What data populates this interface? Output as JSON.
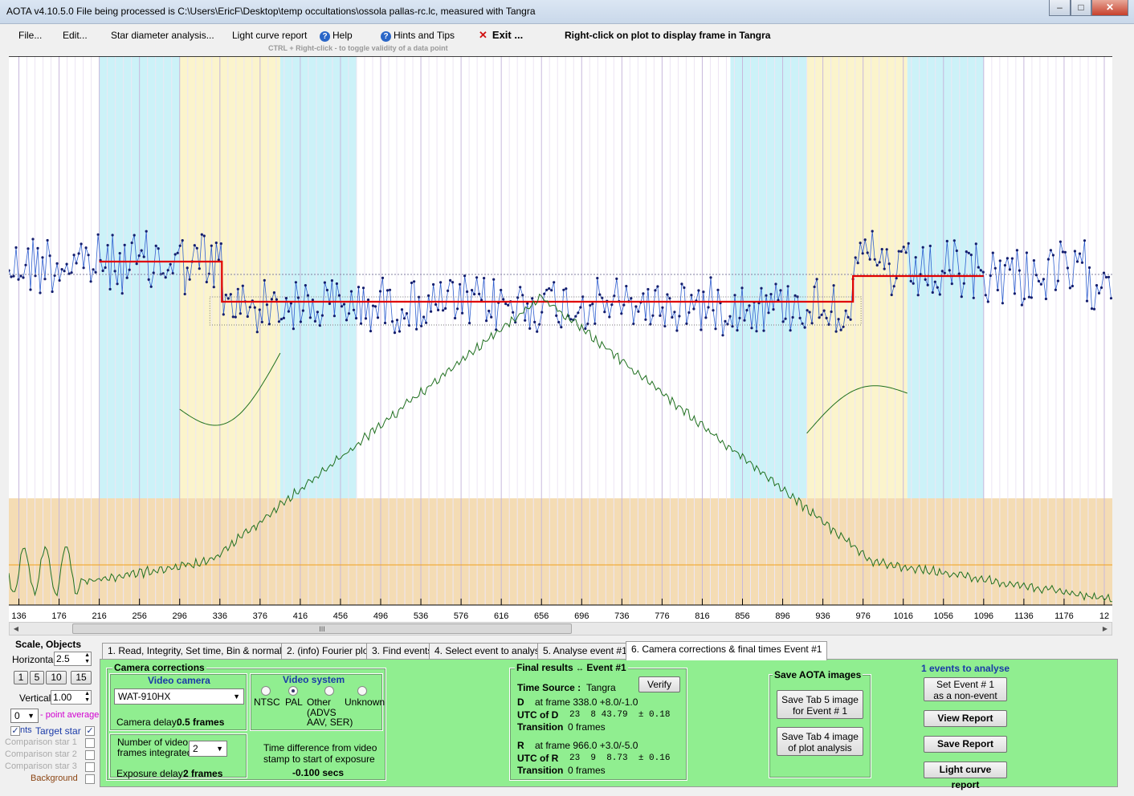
{
  "window": {
    "title": "AOTA v4.10.5.0    File being processed is C:\\Users\\EricF\\Desktop\\temp occultations\\ossola pallas-rc.lc, measured with Tangra"
  },
  "menu": {
    "file": "File...",
    "edit": "Edit...",
    "star_diameter": "Star diameter analysis...",
    "light_curve_report": "Light curve report",
    "help": "Help",
    "hints": "Hints and Tips",
    "exit": "Exit ...",
    "right_click_hint": "Right-click on plot to display frame in Tangra",
    "ctrl_hint": "CTRL + Right-click   -   to toggle validity of a data point"
  },
  "chart_data": {
    "type": "line",
    "x_ticks": [
      "136",
      "176",
      "216",
      "256",
      "296",
      "336",
      "376",
      "416",
      "456",
      "496",
      "536",
      "576",
      "616",
      "656",
      "696",
      "736",
      "776",
      "816",
      "856",
      "896",
      "936",
      "976",
      "1016",
      "1056",
      "1096",
      "1136",
      "1176",
      "12"
    ],
    "x_range": [
      126,
      1224
    ],
    "regions": [
      {
        "from": 216,
        "to": 296,
        "color": "#ccf2f8"
      },
      {
        "from": 296,
        "to": 396,
        "color": "#fbf4cc"
      },
      {
        "from": 396,
        "to": 472,
        "color": "#ccf2f8"
      },
      {
        "from": 844,
        "to": 920,
        "color": "#ccf2f8"
      },
      {
        "from": 920,
        "to": 1020,
        "color": "#fbf4cc"
      },
      {
        "from": 1020,
        "to": 1096,
        "color": "#ccf2f8"
      }
    ],
    "event_model": {
      "baseline_level": 1.0,
      "event_level": 0.58,
      "D_frame": 338.0,
      "R_frame": 966.0
    },
    "series": [
      {
        "name": "Target star",
        "color": "#1a2a8c"
      }
    ]
  },
  "scroll": {
    "thumb_label": "III"
  },
  "left_panel": {
    "scale_objects": "Scale,  Objects",
    "horizontal_label": "Horizontal",
    "horizontal_value": "2.5",
    "btn_1": "1",
    "btn_5": "5",
    "btn_10": "10",
    "btn_15": "15",
    "vertical_label": "Vertical",
    "vertical_value": "1.00",
    "point_avg_value": "0",
    "point_avg_label": "- point average",
    "pts_label": "nts",
    "target_star": "Target star",
    "comp1": "Comparison star 1",
    "comp2": "Comparison star 2",
    "comp3": "Comparison star 3",
    "background": "Background"
  },
  "tabs": [
    "1.  Read, Integrity, Set time, Bin & normalise",
    "2. (info)  Fourier plot",
    "3. Find events",
    "4. Select event to analyse",
    "5. Analyse event #1",
    "6. Camera corrections & final times Event #1"
  ],
  "camera": {
    "group": "Camera corrections",
    "video_camera": "Video camera",
    "camera_model": "WAT-910HX",
    "camera_delay_label": "Camera delay:",
    "camera_delay_value": "0.5 frames",
    "video_system": "Video system",
    "ntsc": "NTSC",
    "pal": "PAL",
    "other": "Other",
    "other_sub1": "(ADVS",
    "other_sub2": "AAV, SER)",
    "unknown": "Unknown",
    "frames_integrated_1": "Number of video",
    "frames_integrated_2": "frames integrated",
    "frames_integrated_value": "2",
    "exposure_delay_label": "Exposure delay:",
    "exposure_delay_value": "2 frames",
    "time_diff_1": "Time difference from video",
    "time_diff_2": "stamp to start of exposure",
    "time_diff_value": "-0.100 secs"
  },
  "results": {
    "group_title": "Final results",
    "event": "Event #1",
    "time_source_label": "Time Source :",
    "time_source_value": "Tangra",
    "verify": "Verify",
    "D_label": "D",
    "D_frame": "at frame 338.0  +8.0/-1.0",
    "utc_D_label": "UTC of D",
    "utc_D_value": "23  8 43.79  ± 0.18",
    "transition_label": "Transition",
    "transition_D": "0 frames",
    "R_label": "R",
    "R_frame": "at frame 966.0  +3.0/-5.0",
    "utc_R_label": "UTC of R",
    "utc_R_value": "23  9  8.73  ± 0.16",
    "transition_R": "0 frames"
  },
  "save_images": {
    "title": "Save AOTA images",
    "tab5_1": "Save Tab 5 image",
    "tab5_2": "for Event # 1",
    "tab4_1": "Save Tab 4 image",
    "tab4_2": "of plot analysis"
  },
  "right_actions": {
    "events_to_analyse": "1  events to analyse",
    "set_event_1": "Set Event # 1",
    "set_event_2": "as a non-event",
    "view_report": "View Report",
    "save_report": "Save Report",
    "lc_report": "Light curve report"
  }
}
